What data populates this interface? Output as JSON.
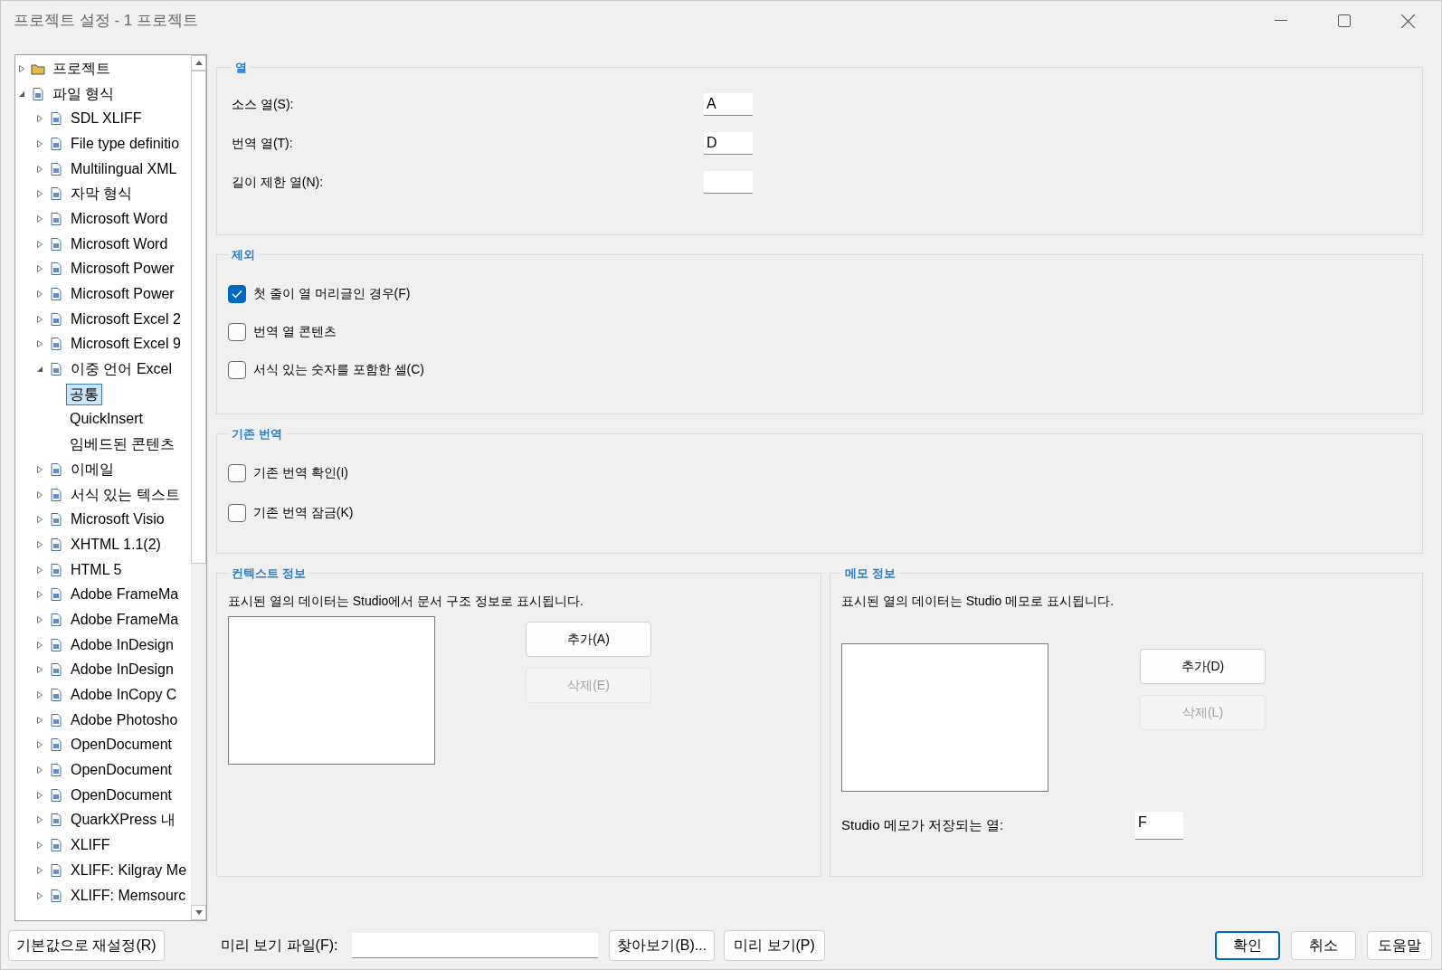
{
  "window": {
    "title": "프로젝트 설정 - 1 프로젝트"
  },
  "tree": {
    "items": [
      {
        "label": "프로젝트",
        "expanded": false,
        "selected": false
      },
      {
        "label": "파일 형식",
        "expanded": true,
        "selected": false,
        "children": [
          {
            "label": "SDL XLIFF",
            "expanded": false,
            "selected": false
          },
          {
            "label": "File type definitio",
            "expanded": false,
            "selected": false
          },
          {
            "label": "Multilingual XML",
            "expanded": false,
            "selected": false
          },
          {
            "label": "자막 형식",
            "expanded": false,
            "selected": false
          },
          {
            "label": "Microsoft Word",
            "expanded": false,
            "selected": false
          },
          {
            "label": "Microsoft Word",
            "expanded": false,
            "selected": false
          },
          {
            "label": "Microsoft Power",
            "expanded": false,
            "selected": false
          },
          {
            "label": "Microsoft Power",
            "expanded": false,
            "selected": false
          },
          {
            "label": "Microsoft Excel 2",
            "expanded": false,
            "selected": false
          },
          {
            "label": "Microsoft Excel 9",
            "expanded": false,
            "selected": false
          },
          {
            "label": "이중 언어 Excel",
            "expanded": true,
            "selected": false,
            "children": [
              {
                "label": "공통",
                "selected": true
              },
              {
                "label": "QuickInsert",
                "selected": false
              },
              {
                "label": "임베드된 콘텐츠",
                "selected": false
              }
            ]
          },
          {
            "label": "이메일",
            "expanded": false,
            "selected": false
          },
          {
            "label": "서식 있는 텍스트",
            "expanded": false,
            "selected": false
          },
          {
            "label": "Microsoft Visio",
            "expanded": false,
            "selected": false
          },
          {
            "label": "XHTML 1.1(2)",
            "expanded": false,
            "selected": false
          },
          {
            "label": "HTML 5",
            "expanded": false,
            "selected": false
          },
          {
            "label": "Adobe FrameMa",
            "expanded": false,
            "selected": false
          },
          {
            "label": "Adobe FrameMa",
            "expanded": false,
            "selected": false
          },
          {
            "label": "Adobe InDesign",
            "expanded": false,
            "selected": false
          },
          {
            "label": "Adobe InDesign",
            "expanded": false,
            "selected": false
          },
          {
            "label": "Adobe InCopy C",
            "expanded": false,
            "selected": false
          },
          {
            "label": "Adobe Photosho",
            "expanded": false,
            "selected": false
          },
          {
            "label": "OpenDocument",
            "expanded": false,
            "selected": false
          },
          {
            "label": "OpenDocument",
            "expanded": false,
            "selected": false
          },
          {
            "label": "OpenDocument",
            "expanded": false,
            "selected": false
          },
          {
            "label": "QuarkXPress 내",
            "expanded": false,
            "selected": false
          },
          {
            "label": "XLIFF",
            "expanded": false,
            "selected": false
          },
          {
            "label": "XLIFF: Kilgray Me",
            "expanded": false,
            "selected": false
          },
          {
            "label": "XLIFF: Memsourc",
            "expanded": false,
            "selected": false
          }
        ]
      }
    ]
  },
  "columns_group": {
    "title": "열",
    "fields": [
      {
        "label": "소스 열(S):",
        "value": "A"
      },
      {
        "label": "번역 열(T):",
        "value": "D"
      },
      {
        "label": "길이 제한 열(N):"
      }
    ]
  },
  "exclude_group": {
    "title": "제외",
    "options": [
      {
        "label": "첫 줄이 열 머리글인 경우(F)",
        "checked": true
      },
      {
        "label": "번역 열 콘텐츠",
        "checked": false
      },
      {
        "label": "서식 있는 숫자를 포함한 셀(C)",
        "checked": false
      }
    ]
  },
  "existing_group": {
    "title": "기존 번역",
    "options": [
      {
        "label": "기존 번역 확인(I)",
        "checked": false
      },
      {
        "label": "기존 번역 잠금(K)",
        "checked": false
      }
    ]
  },
  "context_group": {
    "title": "컨텍스트 정보",
    "description": "표시된 열의 데이터는 Studio에서 문서 구조 정보로 표시됩니다.",
    "buttons": [
      {
        "label": "추가(A)",
        "disabled": false
      },
      {
        "label": "삭제(E)",
        "disabled": true
      }
    ]
  },
  "memo_group": {
    "title": "메모 정보",
    "description": "표시된 열의 데이터는 Studio 메모로 표시됩니다.",
    "buttons": [
      {
        "label": "추가(D)",
        "disabled": false
      },
      {
        "label": "삭제(L)",
        "disabled": true
      }
    ],
    "column_label": "Studio 메모가 저장되는 열:",
    "column_value": "F"
  },
  "footer": {
    "reset_button": "기본값으로 재설정(R)",
    "preview_file_label": "미리 보기 파일(F):",
    "browse_button": "찾아보기(B)...",
    "preview_button": "미리 보기(P)",
    "buttons": [
      {
        "label": "확인",
        "default": true
      },
      {
        "label": "취소",
        "default": false
      },
      {
        "label": "도움말",
        "default": false
      }
    ]
  }
}
